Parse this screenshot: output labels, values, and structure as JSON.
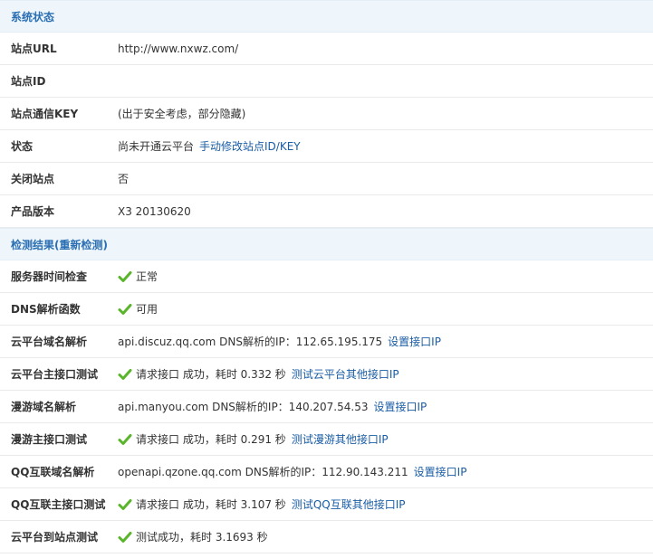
{
  "system_status": {
    "title": "系统状态",
    "site_url_label": "站点URL",
    "site_url_value": "http://www.nxwz.com/",
    "site_id_label": "站点ID",
    "site_id_value": "",
    "site_key_label": "站点通信KEY",
    "site_key_value": "(出于安全考虑，部分隐藏)",
    "status_label": "状态",
    "status_value": "尚未开通云平台",
    "status_link": "手动修改站点ID/KEY",
    "close_site_label": "关闭站点",
    "close_site_value": "否",
    "version_label": "产品版本",
    "version_value": "X3 20130620"
  },
  "detection": {
    "title": "检测结果(重新检测)",
    "server_time_label": "服务器时间检查",
    "server_time_value": "正常",
    "dns_func_label": "DNS解析函数",
    "dns_func_value": "可用",
    "cloud_domain_label": "云平台域名解析",
    "cloud_domain_value": "api.discuz.qq.com DNS解析的IP：112.65.195.175",
    "cloud_domain_link": "设置接口IP",
    "cloud_main_label": "云平台主接口测试",
    "cloud_main_value": "请求接口 成功，耗时 0.332 秒",
    "cloud_main_link": "测试云平台其他接口IP",
    "manyou_domain_label": "漫游域名解析",
    "manyou_domain_value": "api.manyou.com DNS解析的IP：140.207.54.53",
    "manyou_domain_link": "设置接口IP",
    "manyou_main_label": "漫游主接口测试",
    "manyou_main_value": "请求接口 成功，耗时 0.291 秒",
    "manyou_main_link": "测试漫游其他接口IP",
    "qq_domain_label": "QQ互联域名解析",
    "qq_domain_value": "openapi.qzone.qq.com DNS解析的IP：112.90.143.211",
    "qq_domain_link": "设置接口IP",
    "qq_main_label": "QQ互联主接口测试",
    "qq_main_value": "请求接口 成功，耗时 3.107 秒",
    "qq_main_link": "测试QQ互联其他接口IP",
    "cloud_to_site_label": "云平台到站点测试",
    "cloud_to_site_value": "测试成功，耗时 3.1693 秒"
  },
  "colors": {
    "header_bg": "#eef6fc",
    "header_text": "#2b6fb3",
    "link": "#1a5da5",
    "check_green": "#5ab52a"
  },
  "icons": {
    "success": "check-icon"
  }
}
